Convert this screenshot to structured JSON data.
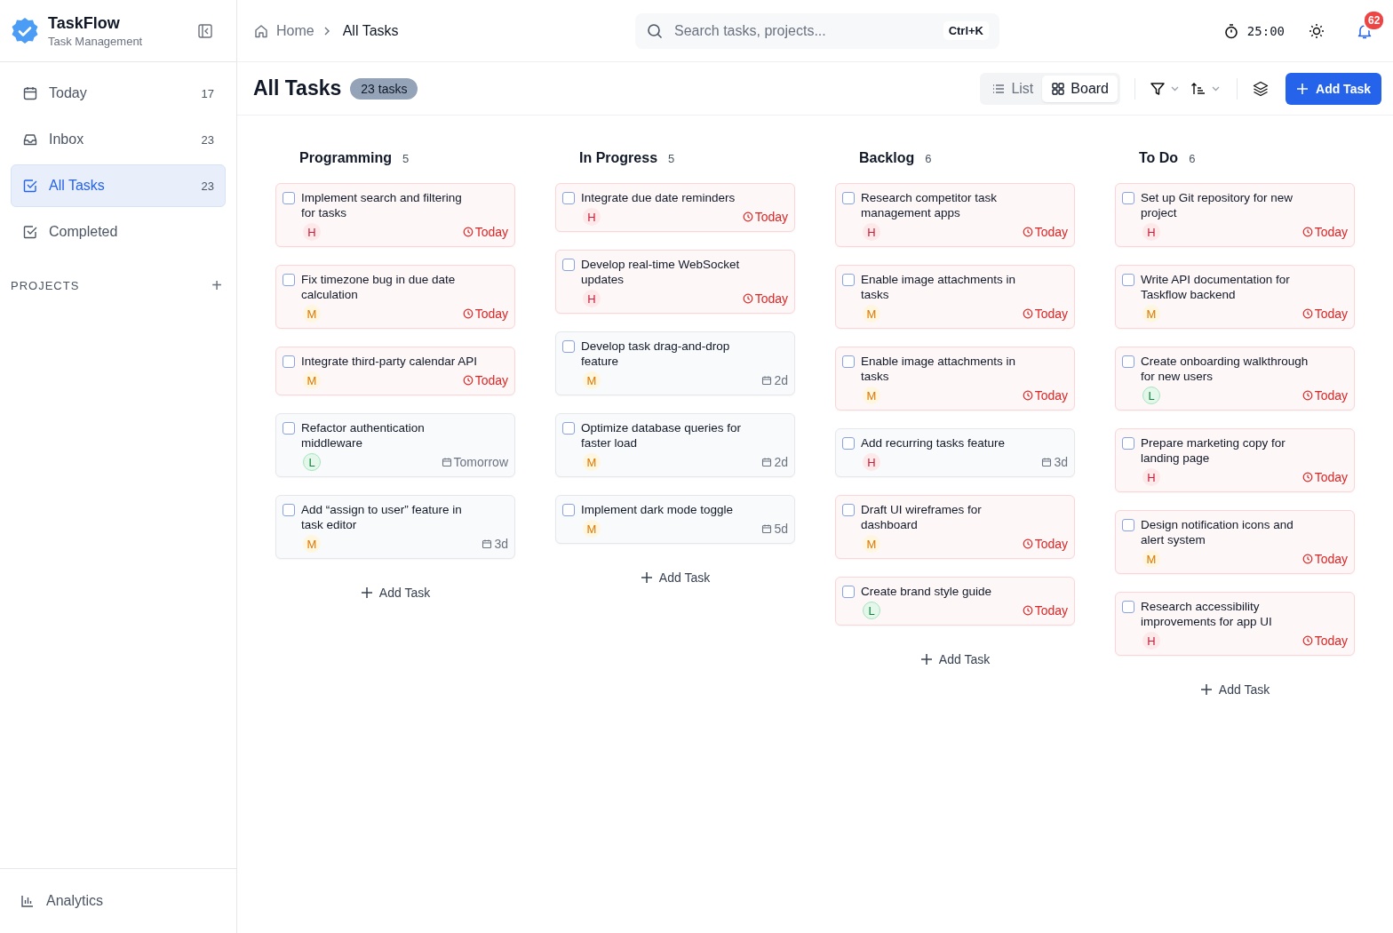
{
  "app": {
    "name": "TaskFlow",
    "subtitle": "Task Management"
  },
  "sidebar": {
    "items": [
      {
        "label": "Today",
        "count": "17",
        "selected": false
      },
      {
        "label": "Inbox",
        "count": "23",
        "selected": false
      },
      {
        "label": "All Tasks",
        "count": "23",
        "selected": true
      },
      {
        "label": "Completed",
        "selected": false
      }
    ],
    "projects_heading": "PROJECTS",
    "projects_add": "+",
    "footer": {
      "label": "Analytics"
    }
  },
  "breadcrumb": [
    "Home",
    "All Tasks"
  ],
  "search": {
    "placeholder": "Search tasks, projects...",
    "shortcut": "Ctrl+K"
  },
  "timer": "25:00",
  "notifications": "62",
  "page": {
    "title": "All Tasks",
    "count": "23 tasks"
  },
  "views": [
    {
      "label": "List",
      "selected": false
    },
    {
      "label": "Board",
      "selected": true
    }
  ],
  "add_task": "Add Task",
  "columns": [
    {
      "title": "Programming",
      "count": "5",
      "add": "Add Task",
      "tasks": [
        {
          "title": "Implement search and filtering for tasks",
          "checked": false,
          "priority": "H",
          "due": "Today",
          "due_today": true
        },
        {
          "title": "Fix timezone bug in due date calculation",
          "checked": false,
          "priority": "M",
          "due": "Today",
          "due_today": true
        },
        {
          "title": "Integrate third-party calendar API",
          "checked": false,
          "priority": "M",
          "due": "Today",
          "due_today": true
        },
        {
          "title": "Refactor authentication middleware",
          "checked": false,
          "priority": "L",
          "due": "Tomorrow",
          "due_today": false
        },
        {
          "title": "Add “assign to user” feature in task editor",
          "checked": false,
          "priority": "M",
          "due": "3d",
          "due_today": false
        }
      ]
    },
    {
      "title": "In Progress",
      "count": "5",
      "add": "Add Task",
      "tasks": [
        {
          "title": "Integrate due date reminders",
          "checked": false,
          "priority": "H",
          "due": "Today",
          "due_today": true
        },
        {
          "title": "Develop real-time WebSocket updates",
          "checked": false,
          "priority": "H",
          "due": "Today",
          "due_today": true
        },
        {
          "title": "Develop task drag-and-drop feature",
          "checked": false,
          "priority": "M",
          "due": "2d",
          "due_today": false
        },
        {
          "title": "Optimize database queries for faster load",
          "checked": false,
          "priority": "M",
          "due": "2d",
          "due_today": false
        },
        {
          "title": "Implement dark mode toggle",
          "checked": false,
          "priority": "M",
          "due": "5d",
          "due_today": false
        }
      ]
    },
    {
      "title": "Backlog",
      "count": "6",
      "add": "Add Task",
      "tasks": [
        {
          "title": "Research competitor task management apps",
          "checked": false,
          "priority": "H",
          "due": "Today",
          "due_today": true
        },
        {
          "title": "Enable image attachments in tasks",
          "checked": false,
          "priority": "M",
          "due": "Today",
          "due_today": true
        },
        {
          "title": "Enable image attachments in tasks",
          "checked": false,
          "priority": "M",
          "due": "Today",
          "due_today": true
        },
        {
          "title": "Add recurring tasks feature",
          "checked": false,
          "priority": "H",
          "due": "3d",
          "due_today": false
        },
        {
          "title": "Draft UI wireframes for dashboard",
          "checked": false,
          "priority": "M",
          "due": "Today",
          "due_today": true
        },
        {
          "title": "Create brand style guide",
          "checked": false,
          "priority": "L",
          "due": "Today",
          "due_today": true
        }
      ]
    },
    {
      "title": "To Do",
      "count": "6",
      "add": "Add Task",
      "tasks": [
        {
          "title": "Set up Git repository for new project",
          "checked": false,
          "priority": "H",
          "due": "Today",
          "due_today": true
        },
        {
          "title": "Write API documentation for Taskflow backend",
          "checked": false,
          "priority": "M",
          "due": "Today",
          "due_today": true
        },
        {
          "title": "Create onboarding walkthrough for new users",
          "checked": false,
          "priority": "L",
          "due": "Today",
          "due_today": true
        },
        {
          "title": "Prepare marketing copy for landing page",
          "checked": false,
          "priority": "H",
          "due": "Today",
          "due_today": true
        },
        {
          "title": "Design notification icons and alert system",
          "checked": false,
          "priority": "M",
          "due": "Today",
          "due_today": true
        },
        {
          "title": "Research accessibility improvements for app UI",
          "checked": false,
          "priority": "H",
          "due": "Today",
          "due_today": true
        }
      ]
    }
  ]
}
